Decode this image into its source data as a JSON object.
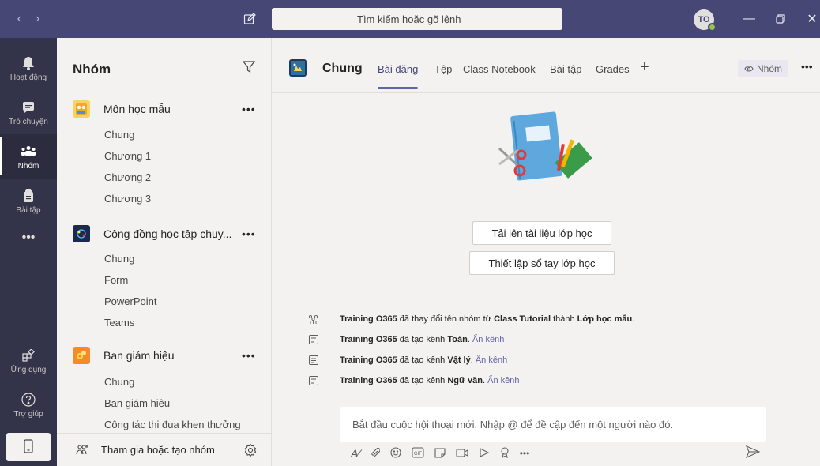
{
  "titlebar": {
    "search_placeholder": "Tìm kiếm hoặc gõ lệnh",
    "avatar_initials": "TO"
  },
  "rail": {
    "items": [
      {
        "label": "Hoạt động",
        "icon": "bell-icon"
      },
      {
        "label": "Trò chuyện",
        "icon": "chat-icon"
      },
      {
        "label": "Nhóm",
        "icon": "teams-icon"
      },
      {
        "label": "Bài tập",
        "icon": "assignments-icon"
      },
      {
        "label": "Ứng dụng",
        "icon": "apps-icon"
      },
      {
        "label": "Trợ giúp",
        "icon": "help-icon"
      }
    ]
  },
  "panel": {
    "title": "Nhóm",
    "footer_label": "Tham gia hoặc tạo nhóm",
    "teams": [
      {
        "name": "Môn học mẫu",
        "channels": [
          "Chung",
          "Chương 1",
          "Chương 2",
          "Chương 3"
        ]
      },
      {
        "name": "Cộng đồng học tập chuy...",
        "channels": [
          "Chung",
          "Form",
          "PowerPoint",
          "Teams"
        ]
      },
      {
        "name": "Ban giám hiệu",
        "channels": [
          "Chung",
          "Ban giám hiệu",
          "Công tác thi đua khen thưởng"
        ]
      }
    ]
  },
  "main": {
    "channel_title": "Chung",
    "tabs": [
      "Bài đăng",
      "Tệp",
      "Class Notebook",
      "Bài tập",
      "Grades"
    ],
    "team_chip": "Nhóm",
    "upload_button": "Tải lên tài liệu lớp học",
    "notebook_button": "Thiết lập sổ tay lớp học",
    "activities": [
      {
        "actor": "Training O365",
        "text1": " đã thay đổi tên nhóm từ ",
        "b1": "Class Tutorial",
        "text2": " thành ",
        "b2": "Lớp học mẫu",
        "text3": ".",
        "link": ""
      },
      {
        "actor": "Training O365",
        "text1": " đã tạo kênh ",
        "b1": "Toán",
        "text2": ". ",
        "b2": "",
        "text3": "",
        "link": "Ẩn kênh"
      },
      {
        "actor": "Training O365",
        "text1": " đã tạo kênh ",
        "b1": "Vật lý",
        "text2": ". ",
        "b2": "",
        "text3": "",
        "link": "Ẩn kênh"
      },
      {
        "actor": "Training O365",
        "text1": " đã tạo kênh ",
        "b1": "Ngữ văn",
        "text2": ". ",
        "b2": "",
        "text3": "",
        "link": "Ẩn kênh"
      }
    ],
    "compose_placeholder": "Bắt đầu cuộc hội thoại mới. Nhập @ để đề cập đến một người nào đó."
  }
}
